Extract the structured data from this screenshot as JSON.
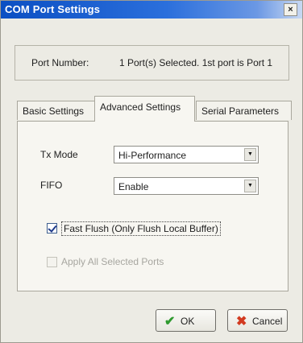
{
  "window": {
    "title": "COM Port Settings",
    "close_glyph": "×"
  },
  "port": {
    "label": "Port Number:",
    "value": "1 Port(s) Selected. 1st port is Port 1"
  },
  "tabs": [
    {
      "label": "Basic Settings",
      "active": false
    },
    {
      "label": "Advanced Settings",
      "active": true
    },
    {
      "label": "Serial Parameters",
      "active": false
    }
  ],
  "advanced": {
    "tx_mode": {
      "label": "Tx Mode",
      "value": "Hi-Performance"
    },
    "fifo": {
      "label": "FIFO",
      "value": "Enable"
    },
    "fast_flush": {
      "label": "Fast Flush (Only Flush Local Buffer)",
      "checked": true
    },
    "apply_all": {
      "label": "Apply All Selected Ports",
      "checked": false,
      "enabled": false
    }
  },
  "buttons": {
    "ok": {
      "label": "OK",
      "icon": "checkmark-icon"
    },
    "cancel": {
      "label": "Cancel",
      "icon": "x-cross-icon"
    }
  },
  "icons": {
    "dropdown": "dropdown-arrow-icon"
  }
}
